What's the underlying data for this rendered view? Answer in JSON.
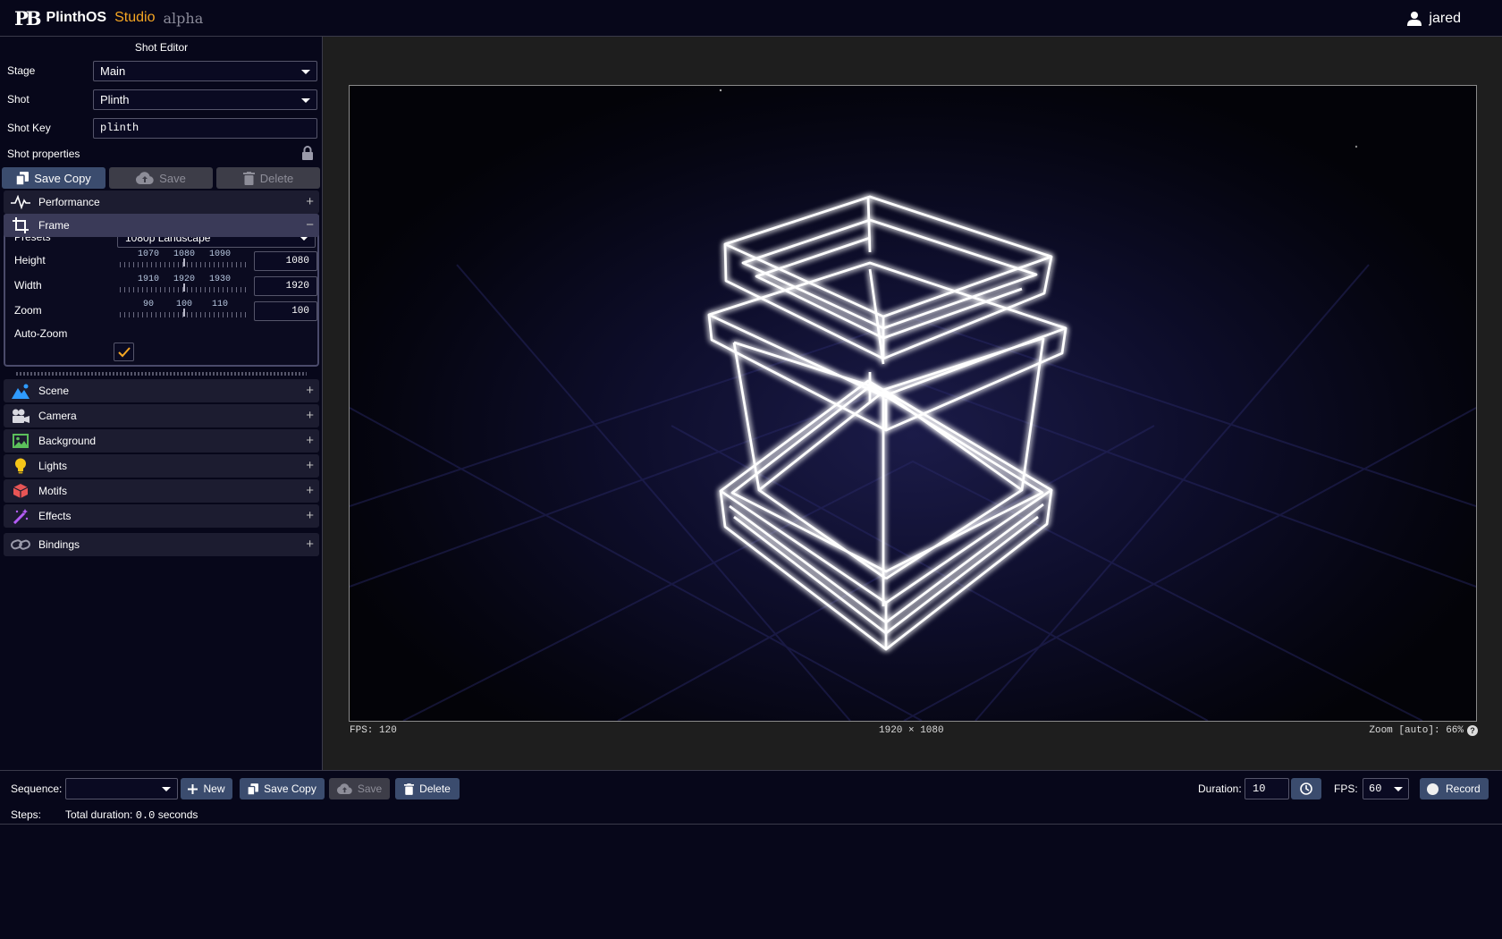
{
  "app": {
    "brand_name": "PlinthOS",
    "brand_studio": "Studio",
    "brand_stage": "alpha",
    "user_name": "jared"
  },
  "shot_editor": {
    "title": "Shot Editor",
    "stage_label": "Stage",
    "stage_value": "Main",
    "shot_label": "Shot",
    "shot_value": "Plinth",
    "shot_key_label": "Shot Key",
    "shot_key_value": "plinth",
    "properties_label": "Shot properties",
    "save_copy_label": "Save Copy",
    "save_label": "Save",
    "delete_label": "Delete"
  },
  "sections": {
    "performance": "Performance",
    "frame": "Frame",
    "scene": "Scene",
    "camera": "Camera",
    "background": "Background",
    "lights": "Lights",
    "motifs": "Motifs",
    "effects": "Effects",
    "bindings": "Bindings",
    "expand_symbol": "+",
    "collapse_symbol": "−"
  },
  "frame": {
    "presets_label": "Presets",
    "presets_value": "1080p Landscape",
    "height_label": "Height",
    "height_ticks": [
      "1070",
      "1080",
      "1090"
    ],
    "height_value": "1080",
    "width_label": "Width",
    "width_ticks": [
      "1910",
      "1920",
      "1930"
    ],
    "width_value": "1920",
    "zoom_label": "Zoom",
    "zoom_ticks": [
      "90",
      "100",
      "110"
    ],
    "zoom_value": "100",
    "autozoom_label": "Auto-Zoom",
    "autozoom_checked": true
  },
  "viewport": {
    "fps_text": "FPS: 120",
    "resolution_text": "1920 × 1080",
    "zoom_text": "Zoom [auto]: 66%",
    "help_glyph": "?"
  },
  "sequence": {
    "label": "Sequence:",
    "selected": "",
    "new_label": "New",
    "save_copy_label": "Save Copy",
    "save_label": "Save",
    "delete_label": "Delete",
    "duration_label": "Duration:",
    "duration_value": "10",
    "fps_label": "FPS:",
    "fps_value": "60",
    "record_label": "Record",
    "steps_label": "Steps:",
    "total_prefix": "Total duration:",
    "total_value": "0.0",
    "total_suffix": "seconds"
  },
  "colors": {
    "accent_orange": "#f5a623",
    "button_blue": "#3b4c6e",
    "panel_bg": "#07071a",
    "wire_glow": "#ffffff"
  }
}
